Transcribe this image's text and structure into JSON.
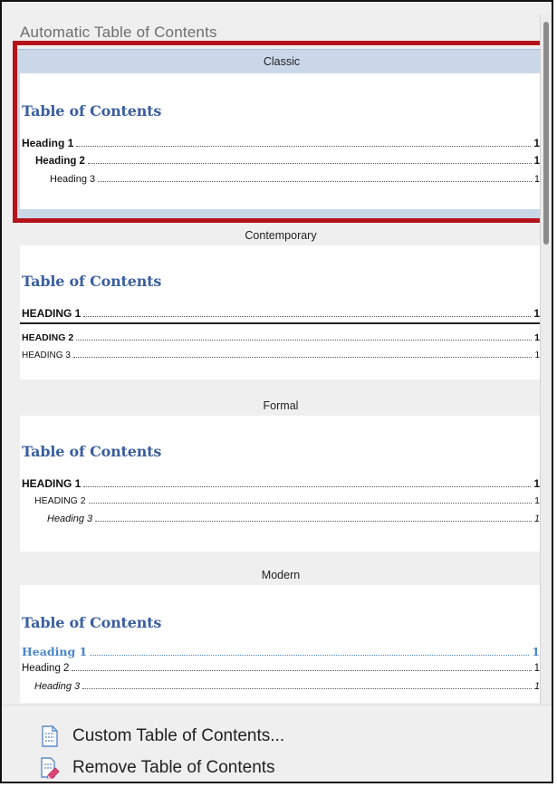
{
  "header": {
    "title": "Automatic Table of Contents"
  },
  "styles": [
    {
      "name": "Classic",
      "heading": "Table of Contents",
      "entries": [
        {
          "label": "Heading 1",
          "page": "1"
        },
        {
          "label": "Heading 2",
          "page": "1"
        },
        {
          "label": "Heading 3",
          "page": "1"
        }
      ]
    },
    {
      "name": "Contemporary",
      "heading": "Table of Contents",
      "entries": [
        {
          "label": "HEADING 1",
          "page": "1"
        },
        {
          "label": "HEADING 2",
          "page": "1"
        },
        {
          "label": "HEADING 3",
          "page": "1"
        }
      ]
    },
    {
      "name": "Formal",
      "heading": "Table of Contents",
      "entries": [
        {
          "label": "HEADING 1",
          "page": "1"
        },
        {
          "label": "HEADING 2",
          "page": "1"
        },
        {
          "label": "Heading 3",
          "page": "1"
        }
      ]
    },
    {
      "name": "Modern",
      "heading": "Table of Contents",
      "entries": [
        {
          "label": "Heading 1",
          "page": "1"
        },
        {
          "label": "Heading 2",
          "page": "1"
        },
        {
          "label": "Heading 3",
          "page": "1"
        }
      ]
    }
  ],
  "commands": {
    "custom": {
      "label": "Custom Table of Contents...",
      "icon": "toc-settings-icon"
    },
    "remove": {
      "label": "Remove Table of Contents",
      "icon": "remove-toc-icon"
    }
  },
  "colors": {
    "heading_blue": "#3b5f9e",
    "modern_link_blue": "#4a86c8",
    "selection_red": "#b5121b"
  }
}
